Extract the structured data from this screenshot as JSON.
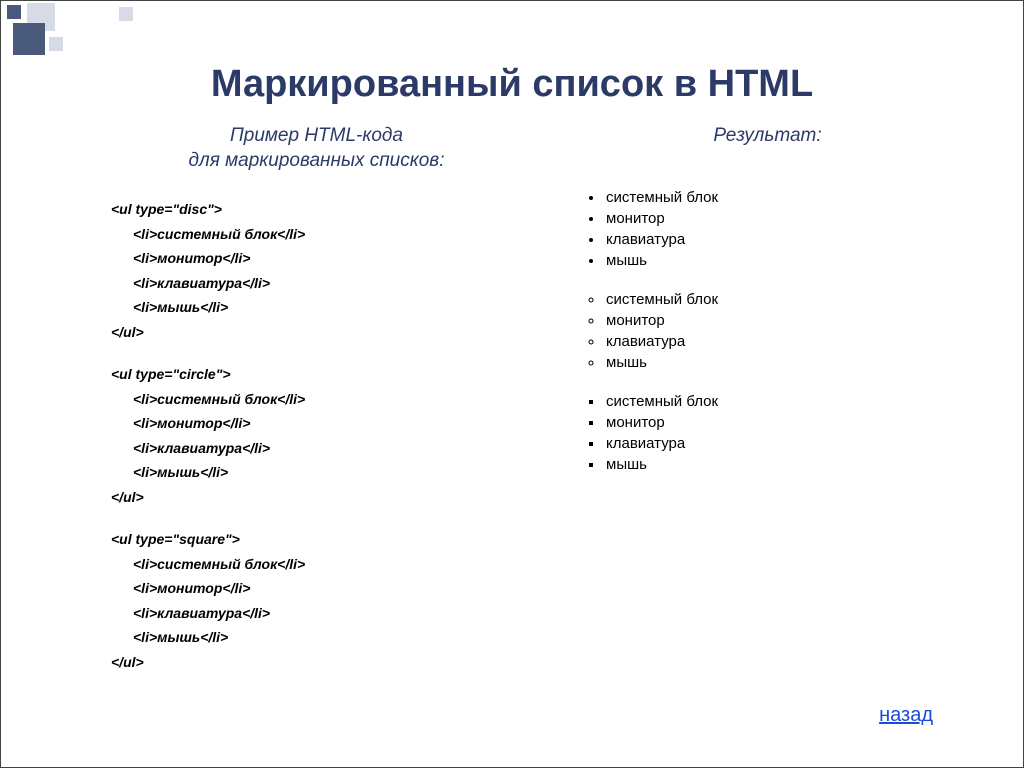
{
  "title": "Маркированный список в HTML",
  "left_heading_line1": "Пример HTML-кода",
  "left_heading_line2": "для маркированных списков:",
  "right_heading": "Результат:",
  "back_label": "назад",
  "code_groups": [
    {
      "open": "<ul type=\"disc\">",
      "items": [
        "<li>системный блок</li>",
        "<li>монитор</li>",
        "<li>клавиатура</li>",
        "<li>мышь</li>"
      ],
      "close": "</ul>"
    },
    {
      "open": "<ul type=\"circle\">",
      "items": [
        "<li>системный блок</li>",
        "<li>монитор</li>",
        "<li>клавиатура</li>",
        "<li>мышь</li>"
      ],
      "close": "</ul>"
    },
    {
      "open": "<ul type=\"square\">",
      "items": [
        "<li>системный блок</li>",
        "<li>монитор</li>",
        "<li>клавиатура</li>",
        "<li>мышь</li>"
      ],
      "close": "</ul>"
    }
  ],
  "result_lists": [
    {
      "style": "disc",
      "items": [
        "системный блок",
        "монитор",
        "клавиатура",
        "мышь"
      ]
    },
    {
      "style": "circle",
      "items": [
        "системный блок",
        "монитор",
        "клавиатура",
        "мышь"
      ]
    },
    {
      "style": "square",
      "items": [
        "системный блок",
        "монитор",
        "клавиатура",
        "мышь"
      ]
    }
  ]
}
